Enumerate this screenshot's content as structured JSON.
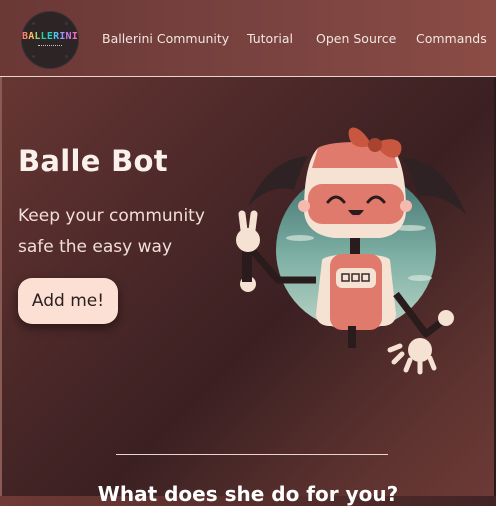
{
  "logo": {
    "text": "BALLERINI"
  },
  "nav": {
    "links": [
      {
        "label": "Ballerini Community"
      },
      {
        "label": "Tutorial"
      },
      {
        "label": "Open Source"
      },
      {
        "label": "Commands"
      }
    ]
  },
  "hero": {
    "title": "Balle Bot",
    "subtitle": "Keep your community safe the easy way",
    "cta": "Add me!"
  },
  "section": {
    "heading": "What does she do for you?"
  },
  "colors": {
    "background": "#4f2a2a",
    "navbar": "#7a4340",
    "button": "#fbe0d3",
    "bot_face": "#f5e2d3",
    "bot_body": "#e07a6c",
    "bot_bow": "#c9573f",
    "bot_hair": "#2f2224",
    "circle_bg": "#6fa59c"
  },
  "icons": [
    "ballerini-logo",
    "balle-bot-illustration"
  ]
}
